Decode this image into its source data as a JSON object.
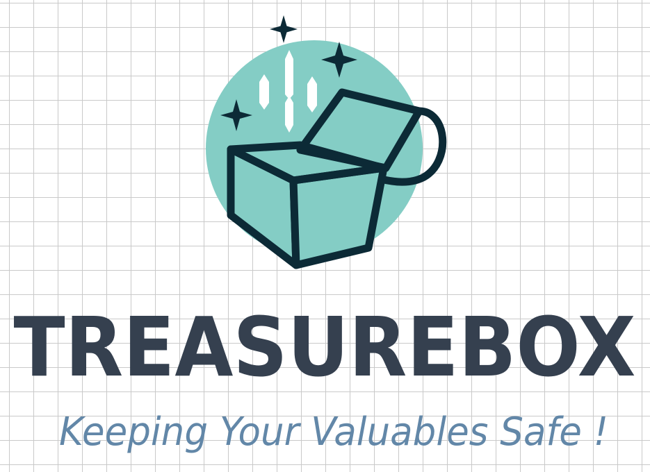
{
  "logo": {
    "brand_name": "TREASUREBOX",
    "tagline": "Keeping Your Valuables Safe !",
    "icon_name": "treasure-chest-icon"
  },
  "colors": {
    "background": "#ffffff",
    "grid_line": "#c9c9c9",
    "circle_fill": "#84cdc5",
    "outline_dark": "#0c2a36",
    "gem_fill": "#ffffff",
    "brand_text": "#35404f",
    "tagline_text": "#6287a8"
  }
}
